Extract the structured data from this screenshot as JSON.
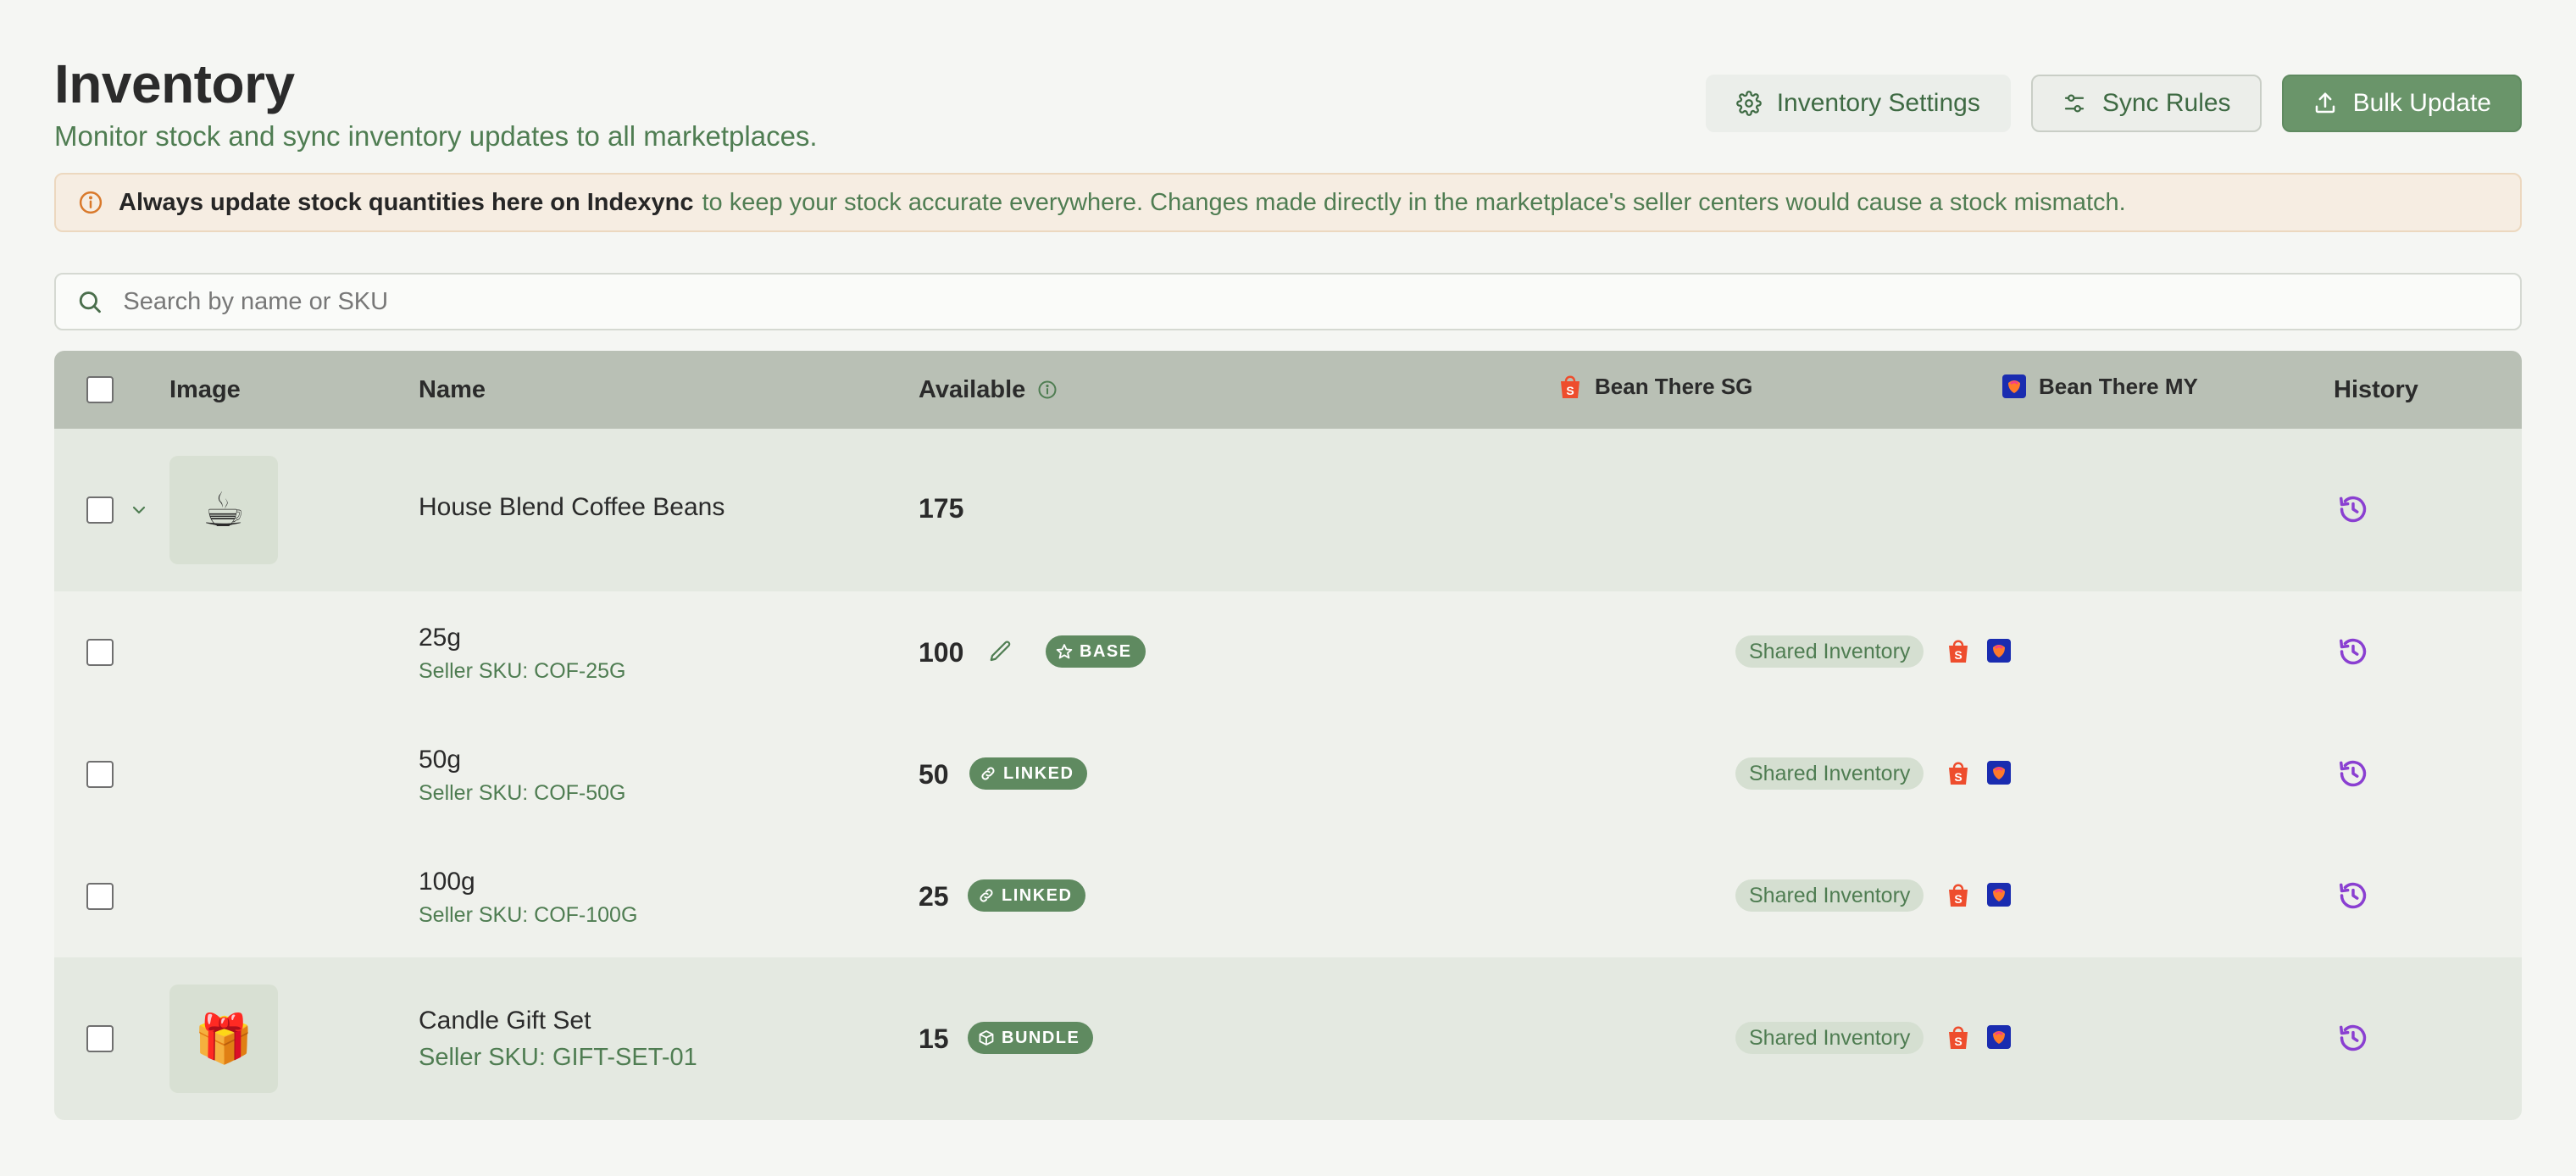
{
  "header": {
    "title": "Inventory",
    "subtitle": "Monitor stock and sync inventory updates to all marketplaces."
  },
  "actions": {
    "settings_label": "Inventory Settings",
    "sync_label": "Sync Rules",
    "bulk_label": "Bulk Update"
  },
  "alert": {
    "bold": "Always update stock quantities here on Indexync",
    "text": "to keep your stock accurate everywhere. Changes made directly in the marketplace's seller centers would cause a stock mismatch."
  },
  "search": {
    "placeholder": "Search by name or SKU"
  },
  "table": {
    "columns": {
      "image": "Image",
      "name": "Name",
      "available": "Available",
      "sg": "Bean There SG",
      "my": "Bean There MY",
      "history": "History"
    },
    "parent": {
      "icon": "☕",
      "name": "House Blend Coffee Beans",
      "qty": "175"
    },
    "variants": [
      {
        "name": "25g",
        "sku": "Seller SKU: COF-25G",
        "qty": "100",
        "badge": "BASE",
        "shared": "Shared Inventory"
      },
      {
        "name": "50g",
        "sku": "Seller SKU: COF-50G",
        "qty": "50",
        "badge": "LINKED",
        "shared": "Shared Inventory"
      },
      {
        "name": "100g",
        "sku": "Seller SKU: COF-100G",
        "qty": "25",
        "badge": "LINKED",
        "shared": "Shared Inventory"
      }
    ],
    "bundle": {
      "icon": "🎁",
      "name": "Candle Gift Set",
      "sku": "Seller SKU: GIFT-SET-01",
      "qty": "15",
      "badge": "BUNDLE",
      "shared": "Shared Inventory"
    }
  },
  "colors": {
    "accent_green": "#5f8a60",
    "history_purple": "#8a3fd1",
    "shopee_orange": "#ee4d2d",
    "lazada_blue": "#1a2cb0"
  },
  "icons": {
    "settings": "gear-icon",
    "sync": "sliders-icon",
    "bulk": "upload-icon",
    "alert": "info-icon",
    "search": "search-icon",
    "history": "history-icon",
    "edit": "pencil-icon"
  }
}
